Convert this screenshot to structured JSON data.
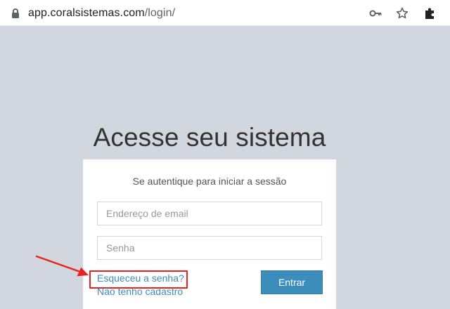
{
  "browser": {
    "url_host": "app.coralsistemas.com",
    "url_path": "/login/",
    "icons": [
      "lock-icon",
      "key-icon",
      "star-icon",
      "puzzle-icon"
    ]
  },
  "page": {
    "title": "Acesse seu sistema",
    "form": {
      "subtitle": "Se autentique para iniciar a sessão",
      "email_placeholder": "Endereço de email",
      "password_placeholder": "Senha",
      "forgot_link": "Esqueceu a senha?",
      "register_link": "Não tenho cadastro",
      "submit_label": "Entrar"
    }
  },
  "annotation": {
    "arrow_color": "#e8231f",
    "box_color": "#e8231f"
  },
  "colors": {
    "background": "#d2d6de",
    "accent": "#3c8dbc"
  }
}
